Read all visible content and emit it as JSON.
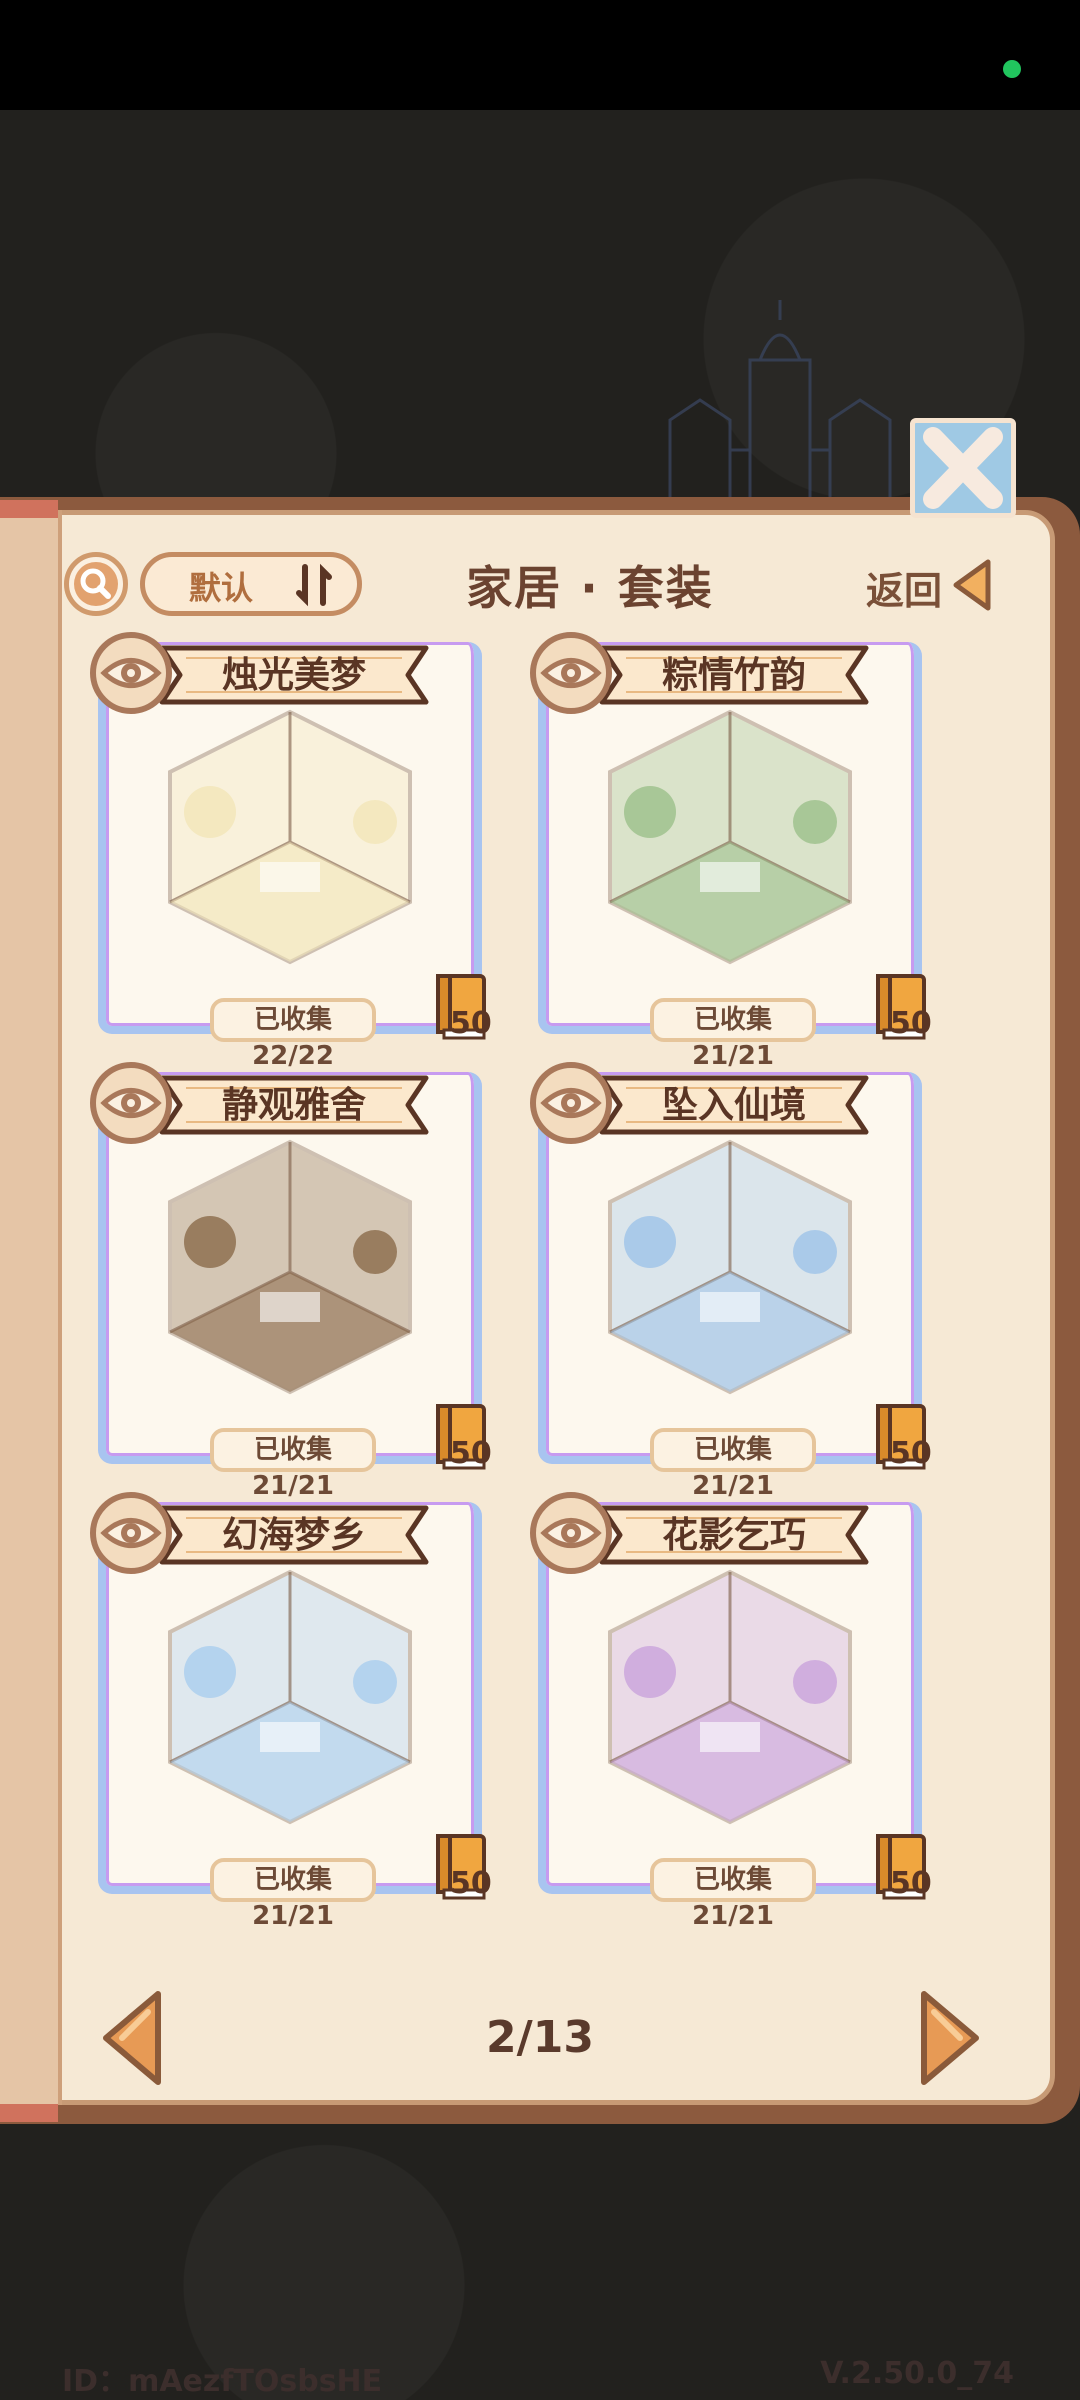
{
  "header": {
    "title": "家居 · 套装",
    "back_label": "返回",
    "sort_label": "默认"
  },
  "sets": [
    {
      "name": "烛光美梦",
      "collected": "已收集 22/22",
      "book_count": "50",
      "theme": "#f2e6b8"
    },
    {
      "name": "粽情竹韵",
      "collected": "已收集 21/21",
      "book_count": "50",
      "theme": "#9bbf8a"
    },
    {
      "name": "静观雅舍",
      "collected": "已收集 21/21",
      "book_count": "50",
      "theme": "#8a6a4a"
    },
    {
      "name": "坠入仙境",
      "collected": "已收集 21/21",
      "book_count": "50",
      "theme": "#9ec3e8"
    },
    {
      "name": "幻海梦乡",
      "collected": "已收集 21/21",
      "book_count": "50",
      "theme": "#a9cdee"
    },
    {
      "name": "花影乞巧",
      "collected": "已收集 21/21",
      "book_count": "50",
      "theme": "#c9a3dc"
    }
  ],
  "pagination": {
    "indicator": "2/13"
  },
  "footer": {
    "id": "ID：mAezfTOsbsHE",
    "version": "V.2.50.0_74"
  },
  "colors": {
    "accent_orange": "#e79a55",
    "frame_blue": "#a8c4f0",
    "frame_purple": "#c79bf0",
    "text_brown": "#5a3524"
  },
  "icons": {
    "search": "search-icon",
    "sort": "sort-icon",
    "back": "back-arrow-icon",
    "close": "close-icon",
    "eye": "eye-icon",
    "book": "book-icon",
    "prev": "prev-page-icon",
    "next": "next-page-icon"
  }
}
